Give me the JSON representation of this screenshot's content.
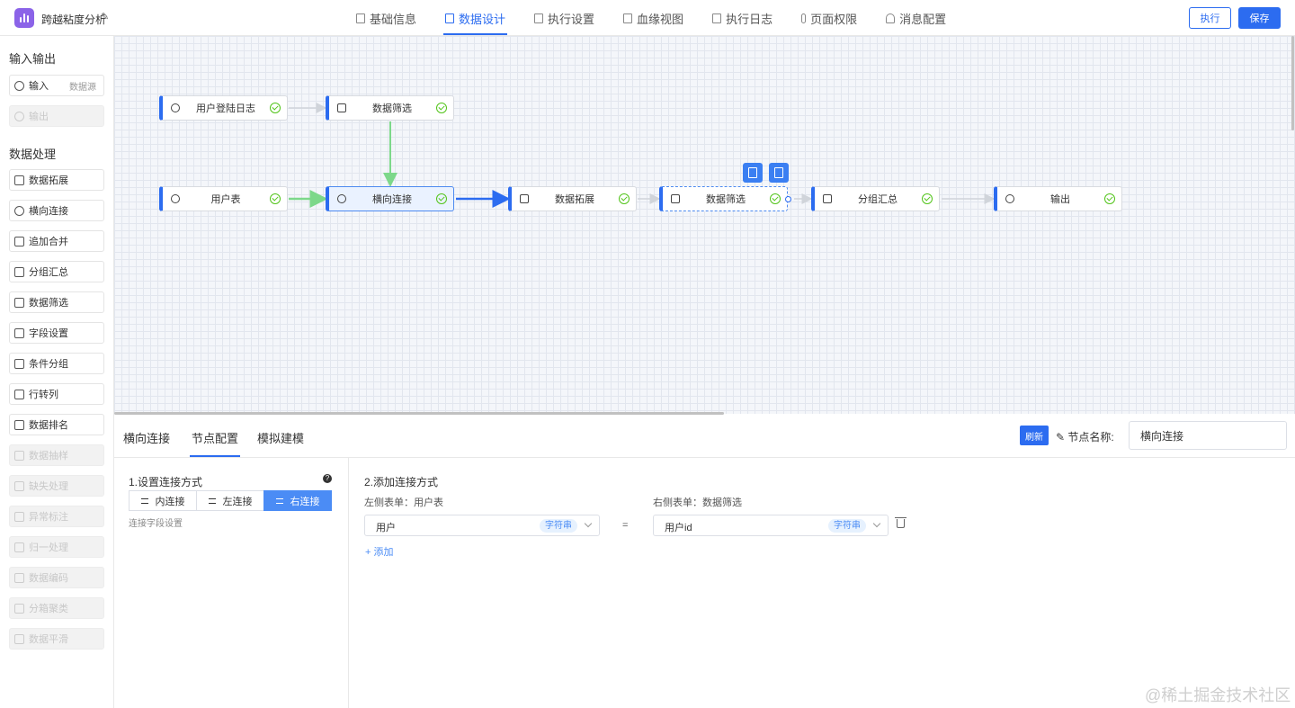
{
  "header": {
    "app_title": "跨越粘度分析",
    "tabs": [
      "基础信息",
      "数据设计",
      "执行设置",
      "血缘视图",
      "执行日志",
      "页面权限",
      "消息配置"
    ],
    "active_tab": "数据设计",
    "exec_label": "执行",
    "save_label": "保存"
  },
  "sidebar": {
    "io_title": "输入输出",
    "io_items": [
      {
        "label": "输入",
        "sub": "数据源",
        "disabled": false
      },
      {
        "label": "输出",
        "disabled": true
      }
    ],
    "proc_title": "数据处理",
    "proc_items": [
      {
        "label": "数据拓展",
        "disabled": false
      },
      {
        "label": "横向连接",
        "disabled": false
      },
      {
        "label": "追加合并",
        "disabled": false
      },
      {
        "label": "分组汇总",
        "disabled": false
      },
      {
        "label": "数据筛选",
        "disabled": false
      },
      {
        "label": "字段设置",
        "disabled": false
      },
      {
        "label": "条件分组",
        "disabled": false
      },
      {
        "label": "行转列",
        "disabled": false
      },
      {
        "label": "数据排名",
        "disabled": false
      },
      {
        "label": "数据抽样",
        "disabled": true
      },
      {
        "label": "缺失处理",
        "disabled": true
      },
      {
        "label": "异常标注",
        "disabled": true
      },
      {
        "label": "归一处理",
        "disabled": true
      },
      {
        "label": "数据编码",
        "disabled": true
      },
      {
        "label": "分箱聚类",
        "disabled": true
      },
      {
        "label": "数据平滑",
        "disabled": true
      }
    ]
  },
  "canvas": {
    "nodes": [
      {
        "id": "n1",
        "label": "用户登陆日志",
        "status": "ok"
      },
      {
        "id": "n2",
        "label": "数据筛选",
        "status": "ok"
      },
      {
        "id": "n3",
        "label": "用户表",
        "status": "ok"
      },
      {
        "id": "n4",
        "label": "横向连接",
        "status": "ok",
        "selected": true
      },
      {
        "id": "n5",
        "label": "数据拓展",
        "status": "ok"
      },
      {
        "id": "n6",
        "label": "数据筛选",
        "status": "ok",
        "hovered": true
      },
      {
        "id": "n7",
        "label": "分组汇总",
        "status": "ok"
      },
      {
        "id": "n8",
        "label": "输出",
        "status": "ok"
      }
    ]
  },
  "panel": {
    "tabs": [
      "横向连接",
      "节点配置",
      "模拟建模"
    ],
    "active_tab": "节点配置",
    "refresh_label": "刷新",
    "node_name_label": "节点名称:",
    "node_name_value": "横向连接",
    "left": {
      "title": "1.设置连接方式",
      "help": "?",
      "join_types": [
        "内连接",
        "左连接",
        "右连接"
      ],
      "active_join": "右连接",
      "field_setting": "连接字段设置"
    },
    "right": {
      "title": "2.添加连接方式",
      "left_table_label": "左侧表单：用户表",
      "right_table_label": "右侧表单：数据筛选",
      "left_field": "用户",
      "left_type": "字符串",
      "right_field": "用户id",
      "right_type": "字符串",
      "equals": "=",
      "add_label": "+ 添加"
    }
  },
  "watermark": "@稀土掘金技术社区",
  "colors": {
    "primary": "#2c6cf0",
    "success": "#52c41a",
    "edge_green": "#7dd88a",
    "edge_gray": "#d0d4da",
    "logo": "#8b63e8"
  }
}
